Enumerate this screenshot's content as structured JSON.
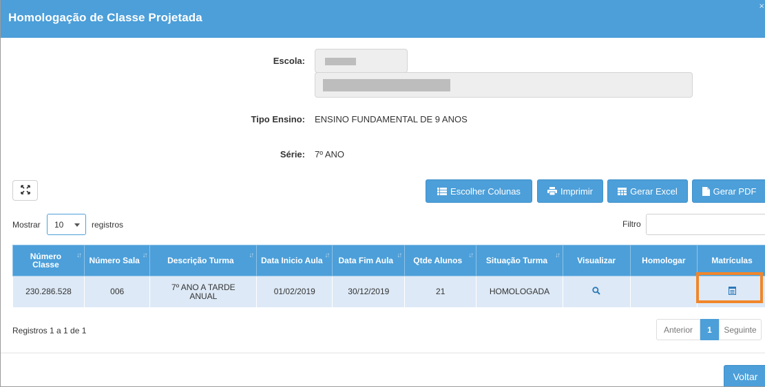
{
  "dialog": {
    "title": "Homologação de Classe Projetada",
    "close_icon": "close-icon"
  },
  "form": {
    "escola_label": "Escola:",
    "tipo_ensino_label": "Tipo Ensino:",
    "tipo_ensino_value": "ENSINO FUNDAMENTAL DE 9 ANOS",
    "serie_label": "Série:",
    "serie_value": "7º ANO"
  },
  "toolbar": {
    "expand_icon": "expand-icon",
    "escolher_colunas": "Escolher Colunas",
    "imprimir": "Imprimir",
    "gerar_excel": "Gerar Excel",
    "gerar_pdf": "Gerar PDF"
  },
  "controls": {
    "mostrar_label": "Mostrar",
    "page_size": "10",
    "registros_label": "registros",
    "filtro_label": "Filtro",
    "filtro_value": ""
  },
  "table": {
    "headers": [
      "Número Classe",
      "Número Sala",
      "Descrição Turma",
      "Data Inicio Aula",
      "Data Fim Aula",
      "Qtde Alunos",
      "Situação Turma",
      "Visualizar",
      "Homologar",
      "Matrículas"
    ],
    "rows": [
      {
        "numero_classe": "230.286.528",
        "numero_sala": "006",
        "descricao_turma": "7º ANO A TARDE ANUAL",
        "data_inicio": "01/02/2019",
        "data_fim": "30/12/2019",
        "qtde_alunos": "21",
        "situacao": "HOMOLOGADA",
        "visualizar_icon": "search-icon",
        "homologar": "",
        "matriculas_icon": "list-document-icon"
      }
    ]
  },
  "footer": {
    "registros_info": "Registros 1 a 1 de 1",
    "anterior": "Anterior",
    "current_page": "1",
    "seguinte": "Seguinte",
    "voltar": "Voltar"
  },
  "colors": {
    "primary": "#4c9fd9",
    "row_bg": "#dde9f6",
    "highlight": "#f0862a"
  }
}
